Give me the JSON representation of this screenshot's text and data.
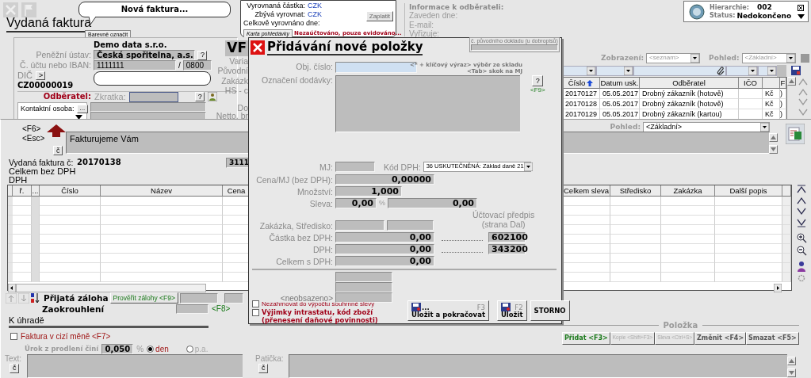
{
  "title": "Vydaná faktura",
  "bubble": "Nová faktura...",
  "color_tab": "Barevně označit",
  "payment": {
    "rows": [
      {
        "label": "Vyrovnaná částka:",
        "value": "CZK"
      },
      {
        "label": "Zbývá vyrovnat:",
        "value": "CZK"
      },
      {
        "label": "Celkově vyrovnáno dne:"
      }
    ],
    "pay_button": "Zaplatit",
    "card_tab": "Karta pohledávky",
    "accounting_status": "Nezaúčtováno, pouze evidováno..."
  },
  "customer_info": {
    "title": "Informace k odběrateli:",
    "fields": [
      "Zaveden dne:",
      "E-mail:",
      "Vyřizuje:"
    ]
  },
  "status_popup": {
    "hierarchy_label": "Hierarchie:",
    "hierarchy": "002",
    "status_label": "Status:",
    "status": "Nedokončeno"
  },
  "header_form": {
    "company": "Demo data s.r.o.",
    "bank_label": "Peněžní ústav:",
    "bank": "Česká spořitelna, a.s.",
    "help": "?",
    "account_label": "Č. účtu nebo IBAN:",
    "account": "1111111",
    "slash": "/",
    "bank_code": "0800",
    "dic_label": "DIČ",
    "dic_button": ">",
    "dic": "CZ00000019",
    "customer_label": "Odběratel:",
    "short_label": "Zkratka:",
    "short_help": "?",
    "contact_label": "Kontaktní osoba:",
    "contact_button": "..."
  },
  "partial_labels": {
    "doc_type": "VF",
    "lines": [
      "Varia",
      "Původní",
      "Zakázk",
      "HS - c"
    ],
    "lower_lines": [
      "Do",
      "Netto, br"
    ]
  },
  "original_doc_label": "č. původního dokladu (u dobropisů)",
  "list": {
    "view_label": "Zobrazení:",
    "view": "<seznam>",
    "layout_label": "Pohled:",
    "layout": "<Základní>",
    "columns": [
      {
        "label": "Číslo",
        "sorted": true
      },
      {
        "label": "Datum usk.",
        "sorted": false
      },
      {
        "label": "Odběratel",
        "sorted": false
      },
      {
        "label": "IČO",
        "sorted": false
      },
      {
        "sorted": false
      },
      {
        "label": "F",
        "sorted": false
      }
    ],
    "rows": [
      {
        "number": "20170127",
        "date": "05.05.2017",
        "customer": "Drobný zákazník (hotově)",
        "column_5": "Kč",
        "column_6": ")"
      },
      {
        "number": "20170128",
        "date": "05.05.2017",
        "customer": "Drobný zákazník (hotově)",
        "column_5": "Kč",
        "column_6": ")"
      },
      {
        "number": "20170129",
        "date": "05.05.2017",
        "customer": "Drobný zákazník (kartou)",
        "column_5": "Kč",
        "column_6": ")"
      }
    ]
  },
  "lower": {
    "keys": [
      "<F6>",
      "<Esc>"
    ],
    "note": "Fakturujeme Vám",
    "char_button": "č",
    "layout_label": "Pohled:",
    "layout": "<Základní>",
    "invoice_label": "Vydaná faktura č:",
    "invoice_number": "20170138",
    "partial_value": "3111",
    "total_label": "Celkem bez DPH",
    "vat_label": "DPH",
    "left_columns": [
      "ř.",
      "...",
      "Číslo",
      "Název",
      "Cena"
    ],
    "right_columns": [
      "Celkem sleva",
      "Středisko",
      "Zakázka",
      "Další popis"
    ],
    "advance": {
      "label": "Přijatá záloha",
      "check_button": "Prověřit zálohy <F9>"
    },
    "rounding": {
      "label": "Zaokrouhlení",
      "key": "<F8>"
    },
    "to_pay": "K úhradě",
    "foreign_currency": {
      "label": "Faktura v cizí měně <F7>",
      "checked": false
    },
    "interest": {
      "label": "Úrok z prodlení činí",
      "value": "0,050",
      "unit": "%",
      "options": [
        {
          "label": "den",
          "selected": true
        },
        {
          "label": "p.a.",
          "selected": false
        }
      ]
    },
    "text_label": "Text:",
    "text_char": "č",
    "footer_label": "Patička:",
    "footer_char": "č",
    "item_group": {
      "title": "Položka",
      "buttons": [
        {
          "label": "Přidat <F3>",
          "kind": "primary",
          "disabled": false
        },
        {
          "label": "Kopie <Shift+F3>",
          "kind": "normal",
          "disabled": true
        },
        {
          "label": "Sleva <Ctrl+S>",
          "kind": "normal",
          "disabled": true
        },
        {
          "label": "Změnit <F4>",
          "kind": "normal",
          "disabled": false
        },
        {
          "label": "Smazat <F5>",
          "kind": "normal",
          "disabled": false
        }
      ]
    }
  },
  "dialog": {
    "title": "Přidávání nové položky",
    "obj_label": "Obj. číslo:",
    "obj_hint": [
      "<* + klíčový výraz> výběr ze skladu",
      "<Tab> skok na MJ"
    ],
    "desc_label": "Označení dodávky:",
    "help": "?",
    "help_key": "<F9>",
    "mj_label": "MJ:",
    "vat_code_label": "Kód DPH:",
    "vat_code": "36 USKUTEČNĚNÁ: Základ daně 21",
    "price_label": "Cena/MJ (bez DPH):",
    "price": "0,00000",
    "qty_label": "Množství:",
    "qty": "1,000",
    "discount_label": "Sleva:",
    "discount_pct": "0,00",
    "pct": "%",
    "discount": "0,00",
    "order_label": "Zakázka, Středisko:",
    "posting_label": "Účtovací předpis",
    "posting_sub": "(strana Dal)",
    "amount_label": "Částka bez DPH:",
    "amount": "0,00",
    "amount_account": "602100",
    "vat_label": "DPH:",
    "vat": "0,00",
    "vat_account": "343200",
    "total_label": "Celkem s DPH:",
    "total": "0,00",
    "unassigned": "<neobsazeno>",
    "checks": [
      {
        "label": "Nezahrnovat do výpočtu souhrnné slevy",
        "checked": false,
        "kind": "plain"
      },
      {
        "label": "Výjimky intrastatu, kód zboží (přenesení daňové povinnosti)",
        "checked": false,
        "kind": "bold"
      }
    ],
    "buttons": [
      {
        "label": "Uložit a pokračovat",
        "key": "F3",
        "suffix": "...",
        "kind": "icon"
      },
      {
        "label": "Uložit",
        "key": "F2",
        "kind": "icon"
      },
      {
        "label": "STORNO",
        "kind": "plain"
      }
    ]
  }
}
